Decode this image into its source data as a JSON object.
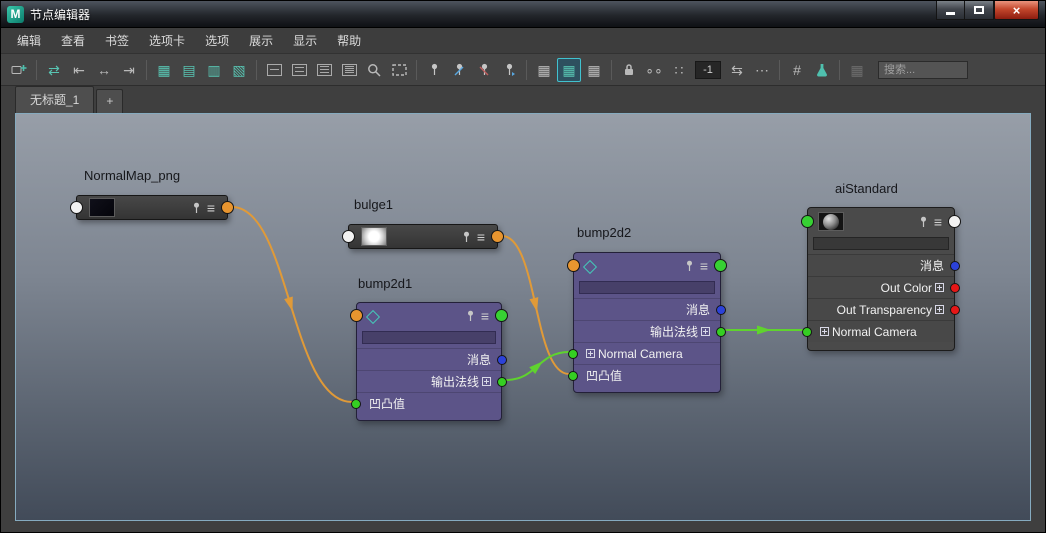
{
  "window": {
    "title": "节点编辑器",
    "controls": {
      "close": "×"
    }
  },
  "menubar": {
    "items": [
      "编辑",
      "查看",
      "书签",
      "选项卡",
      "选项",
      "展示",
      "显示",
      "帮助"
    ]
  },
  "toolbar": {
    "traversal_depth": "-1",
    "search_placeholder": "搜索..."
  },
  "tabbar": {
    "active_tab": "无标题_1",
    "add_tab": "+"
  },
  "icons": {
    "swap": "⇄",
    "in_conn": "⇤",
    "both_conn": "↔",
    "out_conn": "⇥",
    "grid_a": "▦",
    "grid_b": "▤",
    "grid_c": "▥",
    "grid_d": "▧",
    "hamburger": "≡",
    "dots_pair": "∘∘",
    "dots_grid": "∷",
    "dots_row": "⋯",
    "arrows_lr": "⇆",
    "hash": "#",
    "grid_small": "▦",
    "grid_medium": "▦",
    "grid_large": "▦",
    "grid_disabled": "▦"
  },
  "nodes": {
    "normalmap_png": {
      "title": "NormalMap_png"
    },
    "bulge1": {
      "title": "bulge1"
    },
    "bump2d1": {
      "title": "bump2d1",
      "rows": {
        "message": "消息",
        "out_normal": "输出法线",
        "bump_value": "凹凸值"
      }
    },
    "bump2d2": {
      "title": "bump2d2",
      "rows": {
        "message": "消息",
        "out_normal": "输出法线",
        "normal_camera": "Normal Camera",
        "bump_value": "凹凸值"
      }
    },
    "aistandard": {
      "title": "aiStandard",
      "rows": {
        "message": "消息",
        "out_color": "Out Color",
        "out_transparency": "Out Transparency",
        "normal_camera": "Normal Camera"
      }
    }
  },
  "colors": {
    "connection_orange": "#e09a38",
    "connection_green": "#5fd32e",
    "socket_white": "#f2f2f2",
    "socket_orange": "#e8952f",
    "socket_green": "#37d133",
    "dot_blue": "#2c42d8",
    "dot_red": "#e61717",
    "node_purple": "#5c5488",
    "accent_teal": "#45c8b8"
  }
}
